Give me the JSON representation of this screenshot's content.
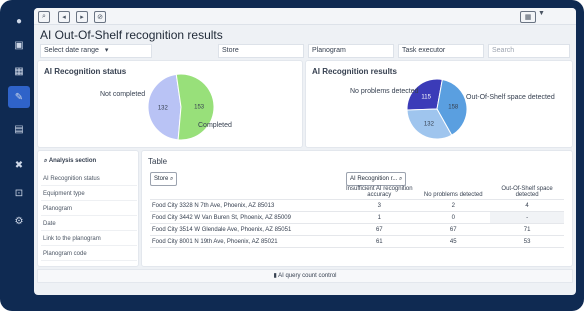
{
  "toolbar": {
    "icons": [
      "selections-icon",
      "back-icon",
      "forward-icon",
      "sheet-icon"
    ]
  },
  "title": "AI Out-Of-Shelf recognition results",
  "filters": {
    "date": "Select date range",
    "store": "Store",
    "planogram": "Planogram",
    "task_executor": "Task executor",
    "search_placeholder": "Search"
  },
  "ai_status": {
    "title": "AI Recognition status",
    "chart_data": {
      "type": "pie",
      "labels": [
        "Not completed",
        "Completed"
      ],
      "values": [
        132,
        153
      ],
      "colors": [
        "#b9c3f5",
        "#98e07a"
      ]
    }
  },
  "ai_results": {
    "title": "AI Recognition results",
    "chart_data": {
      "type": "pie",
      "labels": [
        "No problems detected",
        "Out-Of-Shelf space detected",
        ""
      ],
      "values": [
        115,
        158,
        132
      ],
      "colors": [
        "#3b3bb8",
        "#5a9fe0",
        "#9fc5ee"
      ]
    }
  },
  "analysis": {
    "title": "Analysis section",
    "items": [
      "AI Recognition status",
      "Equipment type",
      "Planogram",
      "Date",
      "Link to the planogram",
      "Planogram code"
    ]
  },
  "table": {
    "title": "Table",
    "store_filter": "Store",
    "ai_filter": "AI Recognition r...",
    "columns": [
      "Insufficient AI recognition accuracy",
      "No problems detected",
      "Out-Of-Shelf space detected"
    ],
    "rows": [
      {
        "store": "Food City 3328 N 7th Ave, Phoenix, AZ 85013",
        "v1": "3",
        "v2": "2",
        "v3": "4"
      },
      {
        "store": "Food City 3442 W Van Buren St, Phoenix, AZ 85009",
        "v1": "1",
        "v2": "0",
        "v3": "-"
      },
      {
        "store": "Food City 3514 W Glendale Ave, Phoenix, AZ 85051",
        "v1": "67",
        "v2": "67",
        "v3": "71"
      },
      {
        "store": "Food City 8001 N 19th Ave, Phoenix, AZ 85021",
        "v1": "61",
        "v2": "45",
        "v3": "53"
      }
    ]
  },
  "footer": {
    "label": "AI query count control"
  }
}
